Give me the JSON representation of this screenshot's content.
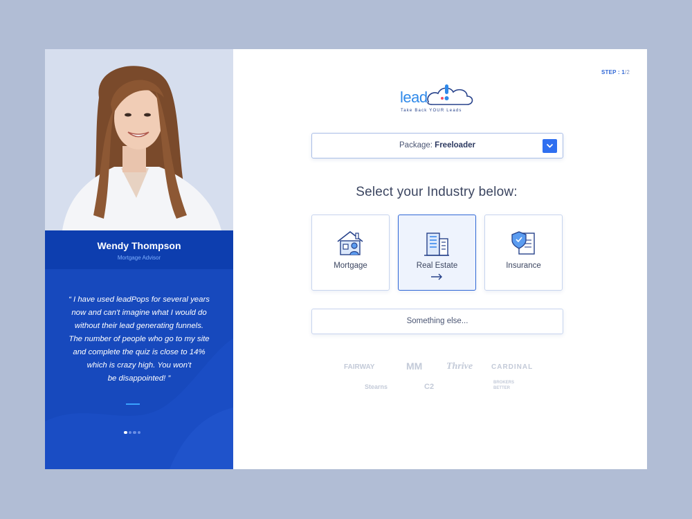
{
  "step": {
    "label": "STEP : ",
    "current": "1",
    "total": "/2"
  },
  "logo": {
    "text": "lead",
    "tagline": "Take Back YOUR Leads"
  },
  "testimonial": {
    "name": "Wendy Thompson",
    "role": "Mortgage Advisor",
    "quote_lines": [
      "“ I have used leadPops for several years",
      "now and can't imagine what I would do",
      "without their lead generating funnels.",
      "The number of people who go to my site",
      "and complete the quiz is close to 14%",
      "which is crazy high. You won't",
      "be disappointed! ”"
    ],
    "carousel_active": 1,
    "carousel_count": 4
  },
  "package": {
    "prefix": "Package: ",
    "value": "Freeloader"
  },
  "heading": "Select your Industry below:",
  "industries": [
    {
      "label": "Mortgage",
      "icon": "house-icon",
      "selected": false
    },
    {
      "label": "Real Estate",
      "icon": "building-icon",
      "selected": true
    },
    {
      "label": "Insurance",
      "icon": "shield-document-icon",
      "selected": false
    }
  ],
  "other_option": "Something else...",
  "partners": [
    "FAIRWAY",
    "MM",
    "Thrive",
    "CARDINAL",
    "Stearns",
    "C2",
    "BROKERS BETTER"
  ],
  "colors": {
    "background": "#b1bdd5",
    "panel_blue": "#1749bd",
    "accent": "#2f6ff0",
    "text": "#3b4560"
  }
}
